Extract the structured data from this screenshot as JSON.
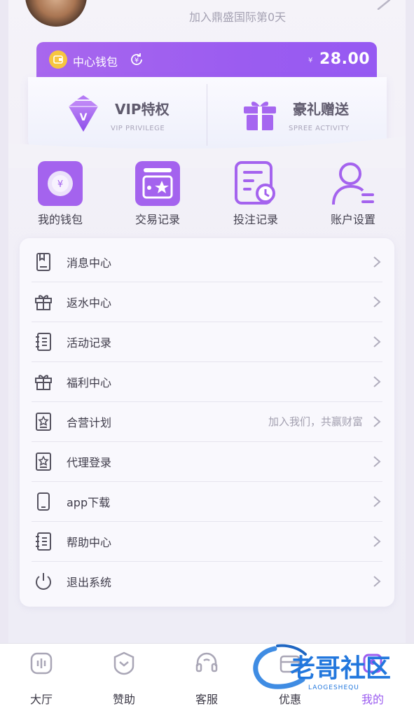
{
  "profile": {
    "join_text": "加入鼎盛国际第0天"
  },
  "wallet": {
    "label": "中心钱包",
    "currency": "¥",
    "amount": "28.00"
  },
  "promo": {
    "vip": {
      "title": "VIP特权",
      "subtitle": "VIP PRIVILEGE"
    },
    "gift": {
      "title": "豪礼赠送",
      "subtitle": "SPREE ACTIVITY"
    }
  },
  "quick_actions": [
    {
      "label": "我的钱包",
      "icon": "wallet-icon"
    },
    {
      "label": "交易记录",
      "icon": "transaction-record-icon"
    },
    {
      "label": "投注记录",
      "icon": "bet-record-icon"
    },
    {
      "label": "账户设置",
      "icon": "account-settings-icon"
    }
  ],
  "menu": [
    {
      "label": "消息中心",
      "icon": "message-icon",
      "extra": ""
    },
    {
      "label": "返水中心",
      "icon": "gift-box-icon",
      "extra": ""
    },
    {
      "label": "活动记录",
      "icon": "list-icon",
      "extra": ""
    },
    {
      "label": "福利中心",
      "icon": "gift-box-icon",
      "extra": ""
    },
    {
      "label": "合营计划",
      "icon": "star-badge-icon",
      "extra": "加入我们，共赢财富"
    },
    {
      "label": "代理登录",
      "icon": "star-badge-icon",
      "extra": ""
    },
    {
      "label": "app下载",
      "icon": "phone-icon",
      "extra": ""
    },
    {
      "label": "帮助中心",
      "icon": "list-icon",
      "extra": ""
    },
    {
      "label": "退出系统",
      "icon": "power-icon",
      "extra": ""
    }
  ],
  "nav": [
    {
      "label": "大厅",
      "icon": "lobby-icon",
      "active": false
    },
    {
      "label": "赞助",
      "icon": "sponsor-icon",
      "active": false
    },
    {
      "label": "客服",
      "icon": "headset-icon",
      "active": false
    },
    {
      "label": "优惠",
      "icon": "promo-icon",
      "active": false
    },
    {
      "label": "我的",
      "icon": "profile-icon",
      "active": true
    }
  ],
  "watermark": {
    "main": "老哥社区",
    "sub": "LAOGESHEQU"
  },
  "colors": {
    "accent": "#9b5cf0",
    "text": "#3f3c4a",
    "muted": "#a3a0b0"
  }
}
